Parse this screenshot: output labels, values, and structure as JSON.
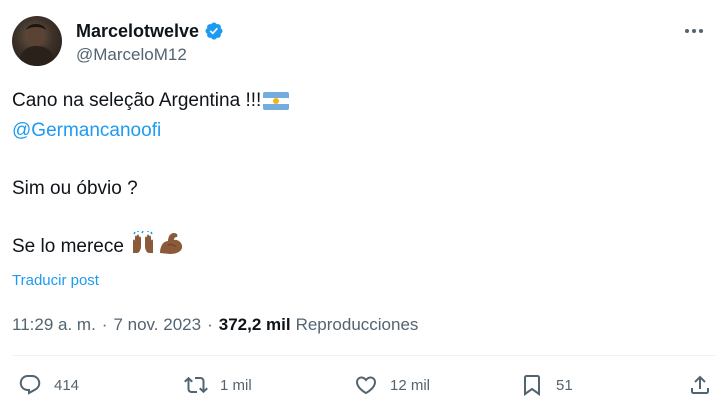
{
  "author": {
    "display_name": "Marcelotwelve",
    "handle": "@MarceloM12",
    "verified": true
  },
  "tweet": {
    "line1": "Cano na seleção Argentina !!!",
    "mention": "@Germancanoofi",
    "line3": "Sim ou óbvio ?",
    "line4": "Se lo merece",
    "emojis": [
      "raising-hands-icon",
      "flexed-biceps-icon"
    ],
    "flag": "argentina-flag-icon",
    "translate_label": "Traducir post"
  },
  "meta": {
    "time": "11:29 a. m.",
    "date": "7 nov. 2023",
    "views_count": "372,2 mil",
    "views_label": "Reproducciones"
  },
  "actions": {
    "replies": "414",
    "reposts": "1 mil",
    "likes": "12 mil",
    "bookmarks": "51"
  },
  "colors": {
    "link": "#1d9bf0",
    "text": "#0f1419",
    "secondary": "#536471"
  }
}
